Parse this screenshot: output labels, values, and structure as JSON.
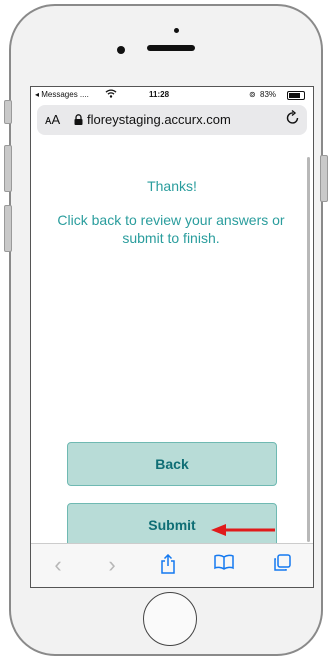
{
  "status": {
    "carrier": "◂ Messages ....",
    "time": "11:28",
    "battery": "83%"
  },
  "browser": {
    "aa_label": "ᴀA",
    "url": "floreystaging.accurx.com"
  },
  "content": {
    "title": "Thanks!",
    "message": "Click back to review your answers or submit to finish."
  },
  "buttons": {
    "back": "Back",
    "submit": "Submit"
  },
  "icons": {
    "back": "chevron-left-icon",
    "forward": "chevron-right-icon",
    "share": "share-icon",
    "bookmarks": "book-icon",
    "tabs": "tabs-icon",
    "reload": "reload-icon",
    "lock": "lock-icon",
    "wifi": "wifi-icon"
  },
  "colors": {
    "accent_text": "#2a9d9d",
    "button_bg": "#b8dcd7",
    "button_border": "#6fb9b2",
    "button_text": "#0f6e75",
    "annotation_arrow": "#e01b1b",
    "ios_blue": "#1479f0"
  }
}
